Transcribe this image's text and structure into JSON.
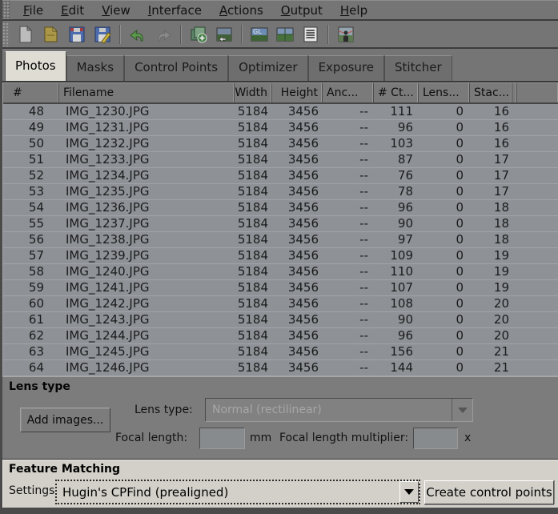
{
  "app": {
    "name": "Hugin panorama editor",
    "active_tab": "Photos"
  },
  "menu": {
    "items": [
      {
        "label": "File"
      },
      {
        "label": "Edit"
      },
      {
        "label": "View"
      },
      {
        "label": "Interface"
      },
      {
        "label": "Actions"
      },
      {
        "label": "Output"
      },
      {
        "label": "Help"
      }
    ]
  },
  "toolbar": {
    "gl_label": "GL",
    "icons": [
      "new-project-icon",
      "open-project-icon",
      "save-project-icon",
      "save-as-icon",
      "undo-icon",
      "redo-icon",
      "add-images-icon",
      "add-time-series-icon",
      "gl-preview-icon",
      "panorama-preview-icon",
      "control-point-table-icon",
      "assistant-icon"
    ]
  },
  "tabs": {
    "items": [
      {
        "label": "Photos",
        "active": true
      },
      {
        "label": "Masks",
        "active": false
      },
      {
        "label": "Control Points",
        "active": false
      },
      {
        "label": "Optimizer",
        "active": false
      },
      {
        "label": "Exposure",
        "active": false
      },
      {
        "label": "Stitcher",
        "active": false
      }
    ]
  },
  "table": {
    "columns": [
      {
        "label": "#"
      },
      {
        "label": "Filename"
      },
      {
        "label": "Width"
      },
      {
        "label": "Height"
      },
      {
        "label": "Anc..."
      },
      {
        "label": "# Ct..."
      },
      {
        "label": "Lens..."
      },
      {
        "label": "Stac..."
      }
    ],
    "rows": [
      [
        48,
        "IMG_1230.JPG",
        5184,
        3456,
        "--",
        111,
        0,
        16
      ],
      [
        49,
        "IMG_1231.JPG",
        5184,
        3456,
        "--",
        96,
        0,
        16
      ],
      [
        50,
        "IMG_1232.JPG",
        5184,
        3456,
        "--",
        103,
        0,
        16
      ],
      [
        51,
        "IMG_1233.JPG",
        5184,
        3456,
        "--",
        87,
        0,
        17
      ],
      [
        52,
        "IMG_1234.JPG",
        5184,
        3456,
        "--",
        76,
        0,
        17
      ],
      [
        53,
        "IMG_1235.JPG",
        5184,
        3456,
        "--",
        78,
        0,
        17
      ],
      [
        54,
        "IMG_1236.JPG",
        5184,
        3456,
        "--",
        96,
        0,
        18
      ],
      [
        55,
        "IMG_1237.JPG",
        5184,
        3456,
        "--",
        90,
        0,
        18
      ],
      [
        56,
        "IMG_1238.JPG",
        5184,
        3456,
        "--",
        97,
        0,
        18
      ],
      [
        57,
        "IMG_1239.JPG",
        5184,
        3456,
        "--",
        109,
        0,
        19
      ],
      [
        58,
        "IMG_1240.JPG",
        5184,
        3456,
        "--",
        110,
        0,
        19
      ],
      [
        59,
        "IMG_1241.JPG",
        5184,
        3456,
        "--",
        107,
        0,
        19
      ],
      [
        60,
        "IMG_1242.JPG",
        5184,
        3456,
        "--",
        108,
        0,
        20
      ],
      [
        61,
        "IMG_1243.JPG",
        5184,
        3456,
        "--",
        90,
        0,
        20
      ],
      [
        62,
        "IMG_1244.JPG",
        5184,
        3456,
        "--",
        96,
        0,
        20
      ],
      [
        63,
        "IMG_1245.JPG",
        5184,
        3456,
        "--",
        156,
        0,
        21
      ],
      [
        64,
        "IMG_1246.JPG",
        5184,
        3456,
        "--",
        144,
        0,
        21
      ]
    ]
  },
  "lens_panel": {
    "title": "Lens type",
    "add_images_label": "Add images...",
    "lens_type_label": "Lens type:",
    "lens_type_value": "Normal (rectilinear)",
    "focal_length_label": "Focal length:",
    "focal_length_value": "",
    "mm_label": "mm",
    "multiplier_label": "Focal length multiplier:",
    "multiplier_value": "",
    "x_label": "x"
  },
  "feature_panel": {
    "title": "Feature Matching",
    "settings_label": "Settings:",
    "settings_value": "Hugin's CPFind (prealigned)",
    "create_button_label": "Create control points"
  },
  "colors": {
    "chrome_gray": "#757575",
    "dark_line": "#3c3c3c",
    "active_tab": "#dfdcd4",
    "table_row": "#8e9196",
    "panel_dark": "#7c7c7c",
    "panel_light": "#d3d0c9",
    "disabled_text": "#a6a6a6"
  }
}
